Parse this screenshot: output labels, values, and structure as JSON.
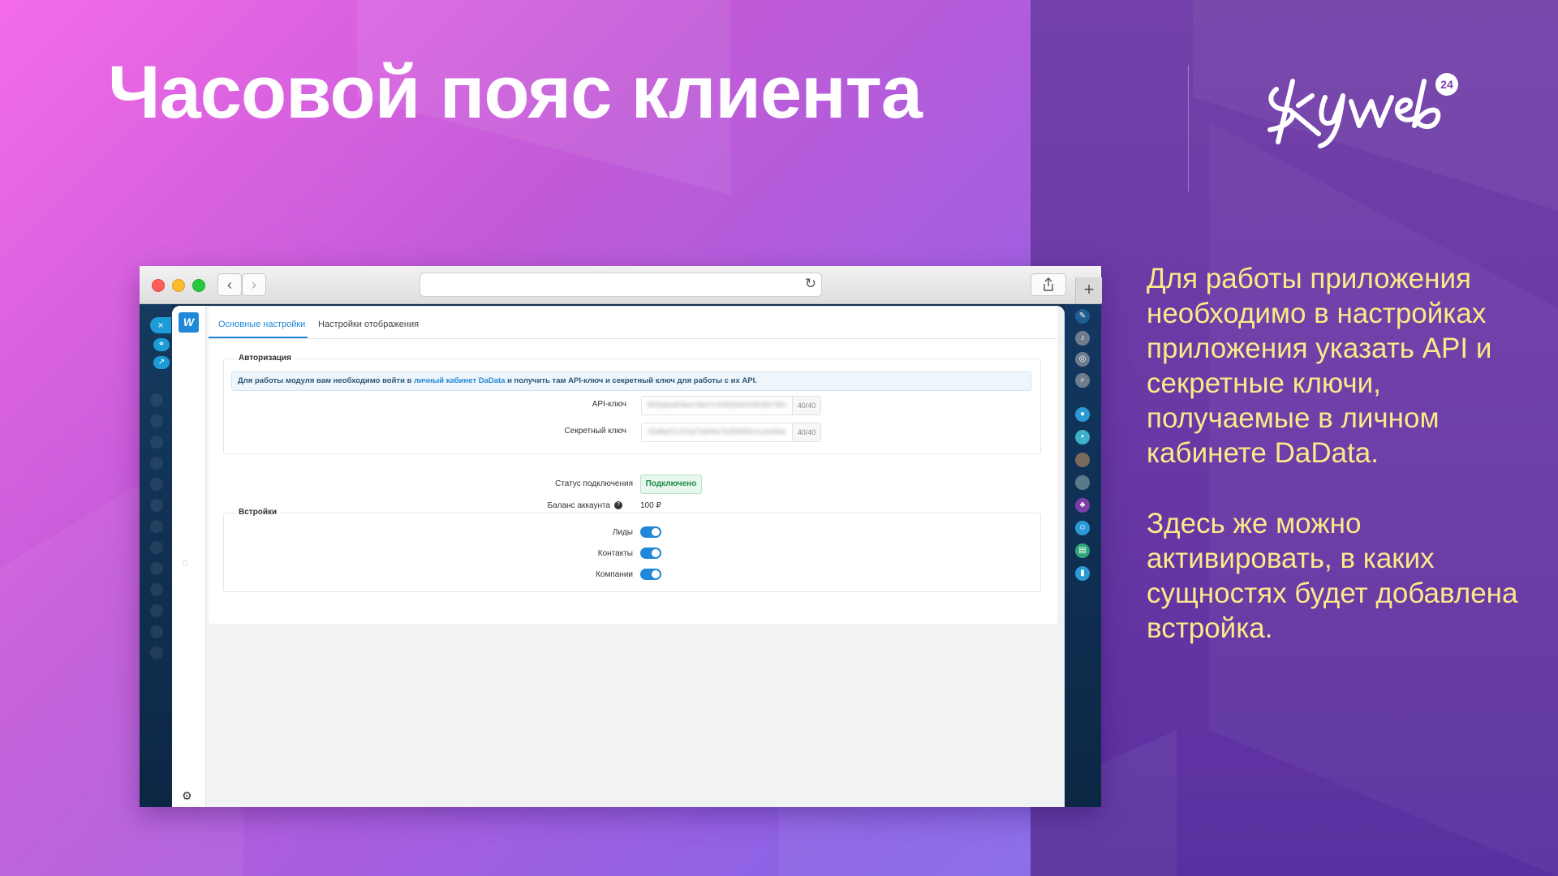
{
  "slide": {
    "title": "Часовой пояс клиента",
    "logo_text": "Skyweb",
    "logo_badge": "24",
    "description_1": "Для работы приложения необходимо в настройках приложения указать API и секретные ключи, получаемые в личном кабинете DaData.",
    "description_2": "Здесь же можно активировать, в каких сущностях будет добавлена встройка."
  },
  "colors": {
    "accent": "#1f88d9",
    "status_green": "#1d8a47",
    "desc_text": "#fde98a"
  },
  "browser": {
    "address": "",
    "back_icon": "chevron-left-icon",
    "forward_icon": "chevron-right-icon",
    "reload_icon": "reload-icon",
    "share_icon": "share-icon",
    "new_tab_icon": "plus-icon"
  },
  "app": {
    "tabs": [
      {
        "label": "Основные настройки",
        "active": true
      },
      {
        "label": "Настройки отображения",
        "active": false
      }
    ],
    "auth": {
      "legend": "Авторизация",
      "info_prefix": "Для работы модуля вам необходимо войти в ",
      "info_link": "личный кабинет DaData",
      "info_suffix": " и получить там API-ключ и секретный ключ для работы с их API.",
      "api_key_label": "API-ключ",
      "api_key_value": "863a9ed04ea7dee7c41f52be919918073617d9",
      "api_key_counter": "40/40",
      "secret_key_label": "Секретный ключ",
      "secret_key_value": "42d8a37c47a37ab94e7fc835f50c1cbd46ad34",
      "secret_key_counter": "40/40"
    },
    "status": {
      "label": "Статус подключения",
      "value": "Подключено"
    },
    "balance": {
      "label": "Баланс аккаунта",
      "value": "100 ₽"
    },
    "embeds": {
      "legend": "Встройки",
      "items": [
        {
          "label": "Лиды",
          "enabled": true
        },
        {
          "label": "Контакты",
          "enabled": true
        },
        {
          "label": "Компании",
          "enabled": true
        }
      ]
    }
  }
}
